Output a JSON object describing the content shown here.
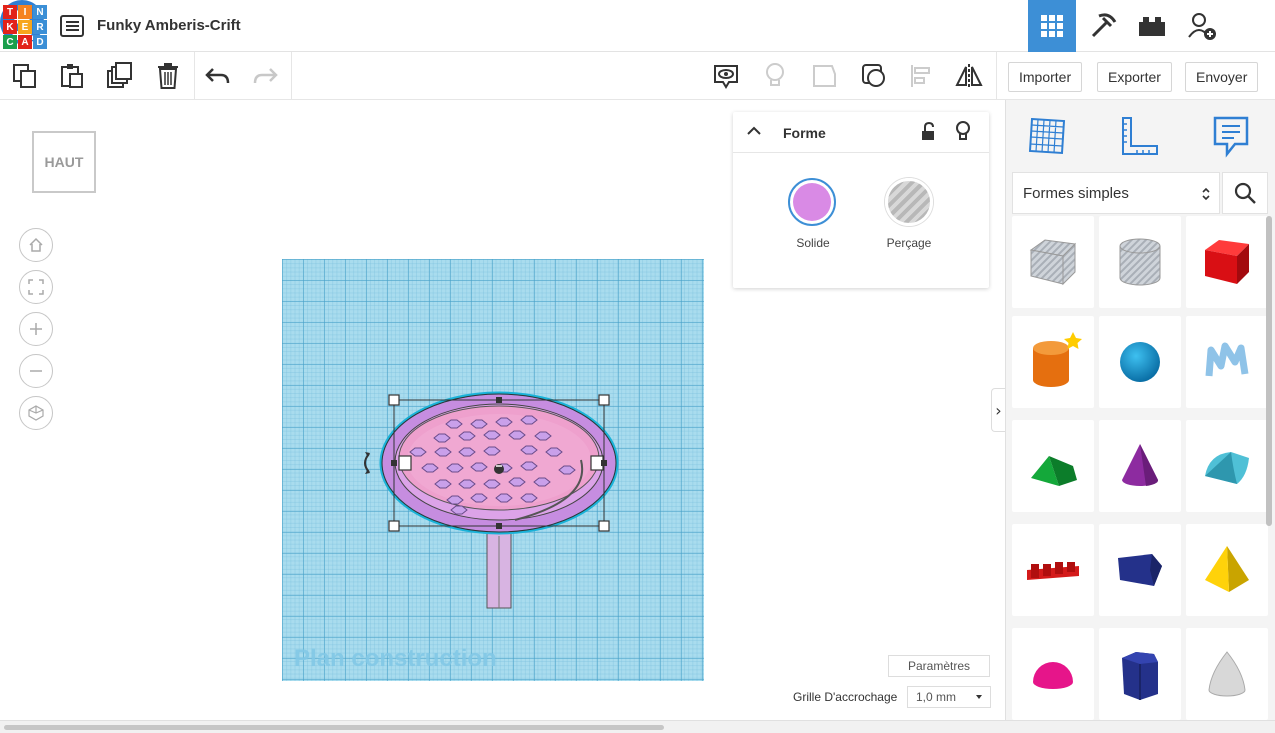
{
  "header": {
    "logo_letters": [
      "T",
      "I",
      "N",
      "K",
      "E",
      "R",
      "C",
      "A",
      "D"
    ],
    "logo_colors": [
      "#e2231a",
      "#f58220",
      "#3b8fd6",
      "#e2231a",
      "#f7a61c",
      "#3b8fd6",
      "#1b9f4c",
      "#e2231a",
      "#3b8fd6"
    ],
    "project_title": "Funky Amberis-Crift",
    "buttons": [
      {
        "name": "view-3d-grid-icon"
      },
      {
        "name": "pickaxe-icon"
      },
      {
        "name": "bricks-icon"
      },
      {
        "name": "add-user-icon"
      }
    ],
    "active_color": "#3d8fd6"
  },
  "toolbar": {
    "left_tools": [
      "copy-icon",
      "paste-icon",
      "duplicate-icon",
      "delete-icon",
      "undo-icon",
      "redo-icon"
    ],
    "right_tools": [
      "notes-visibility-icon",
      "light-bulb-icon",
      "notes-icon",
      "group-icon",
      "align-icon",
      "mirror-icon"
    ],
    "import_label": "Importer",
    "export_label": "Exporter",
    "send_label": "Envoyer"
  },
  "viewport": {
    "view_cube_label": "HAUT",
    "nav_buttons": [
      "home-icon",
      "fit-icon",
      "zoom-in-icon",
      "zoom-out-icon",
      "orthographic-icon"
    ],
    "workplane_label": "Plan construction",
    "params_label": "Paramètres",
    "snap_grid_label": "Grille D'accrochage",
    "snap_grid_value": "1,0 mm"
  },
  "shape_panel": {
    "title": "Forme",
    "solid_label": "Solide",
    "hole_label": "Perçage",
    "solid_color": "#d98ae5"
  },
  "library": {
    "tabs": [
      "workplane-grid-icon",
      "ruler-icon",
      "notes-comment-icon"
    ],
    "category": "Formes simples",
    "shapes": [
      {
        "name": "box-hole"
      },
      {
        "name": "cylinder-hole"
      },
      {
        "name": "box"
      },
      {
        "name": "cylinder"
      },
      {
        "name": "sphere"
      },
      {
        "name": "scribble"
      },
      {
        "name": "roof"
      },
      {
        "name": "cone"
      },
      {
        "name": "round-roof"
      },
      {
        "name": "text"
      },
      {
        "name": "polygon"
      },
      {
        "name": "pyramid"
      },
      {
        "name": "half-sphere"
      },
      {
        "name": "hexagonal-prism"
      },
      {
        "name": "paraboloid"
      }
    ]
  }
}
